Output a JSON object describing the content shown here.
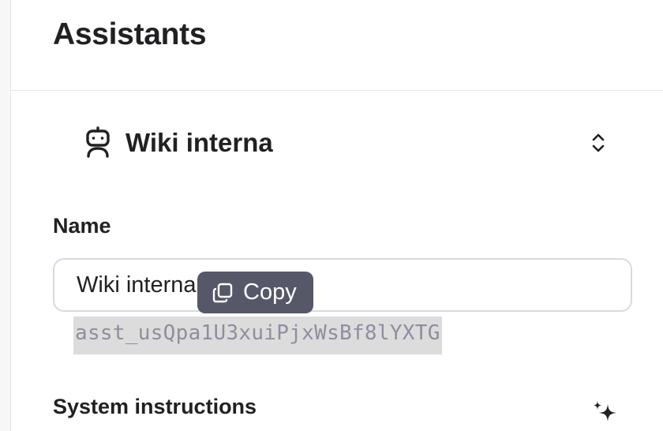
{
  "page": {
    "title": "Assistants"
  },
  "assistant_selector": {
    "name": "Wiki interna",
    "icon": "robot-icon",
    "chevron": "chevron-up-down-icon"
  },
  "form": {
    "name_label": "Name",
    "name_value": "Wiki interna",
    "assistant_id": "asst_usQpa1U3xuiPjxWsBf8lYXTG",
    "system_instructions_label": "System instructions",
    "generate_icon": "sparkle-icon"
  },
  "tooltip": {
    "label": "Copy",
    "icon": "copy-icon"
  },
  "colors": {
    "tooltip_bg": "#565869",
    "id_highlight": "#dcdcdc",
    "border": "#d9d9e3"
  }
}
